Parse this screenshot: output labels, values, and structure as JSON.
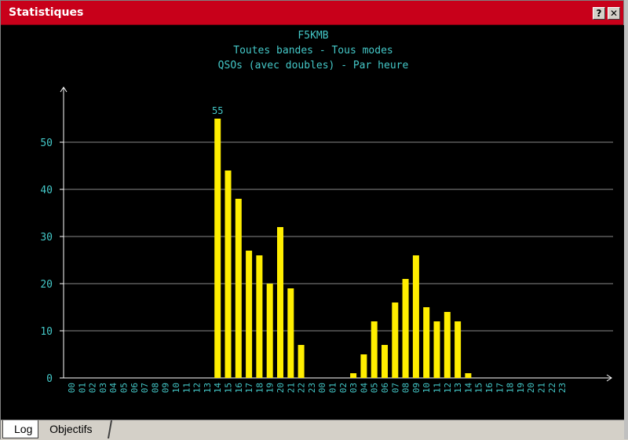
{
  "window": {
    "title": "Statistiques",
    "help_label": "?",
    "close_label": "✕"
  },
  "chart_data": {
    "type": "bar",
    "title": "F5KMB",
    "subtitle1": "Toutes bandes - Tous modes",
    "subtitle2": "QSOs (avec doubles) - Par heure",
    "categories": [
      "00",
      "01",
      "02",
      "03",
      "04",
      "05",
      "06",
      "07",
      "08",
      "09",
      "10",
      "11",
      "12",
      "13",
      "14",
      "15",
      "16",
      "17",
      "18",
      "19",
      "20",
      "21",
      "22",
      "23",
      "00",
      "01",
      "02",
      "03",
      "04",
      "05",
      "06",
      "07",
      "08",
      "09",
      "10",
      "11",
      "12",
      "13",
      "14",
      "15",
      "16",
      "17",
      "18",
      "19",
      "20",
      "21",
      "22",
      "23"
    ],
    "values": [
      0,
      0,
      0,
      0,
      0,
      0,
      0,
      0,
      0,
      0,
      0,
      0,
      0,
      0,
      55,
      44,
      38,
      27,
      26,
      20,
      32,
      19,
      7,
      0,
      0,
      0,
      0,
      1,
      5,
      12,
      7,
      16,
      21,
      26,
      15,
      12,
      14,
      12,
      1,
      0,
      0,
      0,
      0,
      0,
      0,
      0,
      0,
      0
    ],
    "ylim": [
      0,
      60
    ],
    "yticks": [
      "0",
      "10",
      "20",
      "30",
      "40",
      "50"
    ],
    "peak_label": "55",
    "grid": true,
    "bar_color": "#ffee00",
    "text_color": "#44c8c8"
  },
  "tabs": [
    {
      "label": "Log"
    },
    {
      "label": "Objectifs"
    }
  ]
}
